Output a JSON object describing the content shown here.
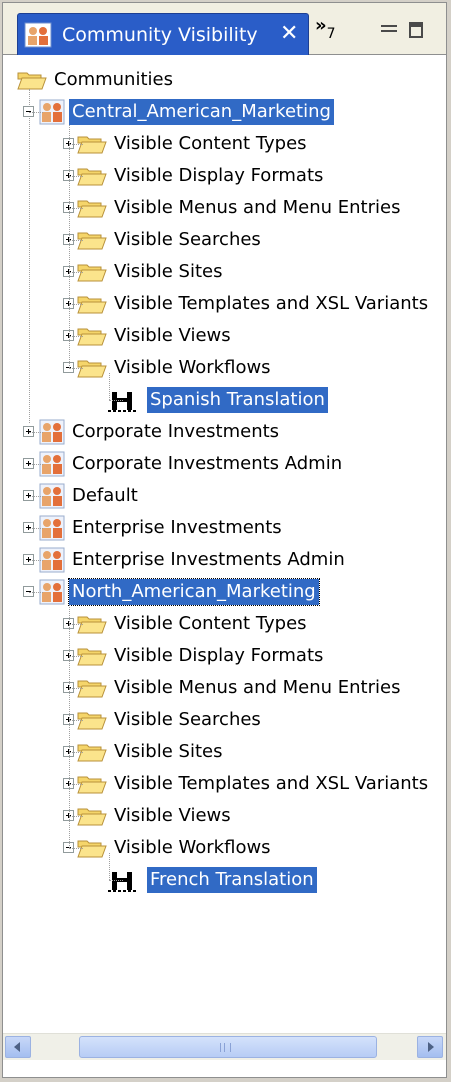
{
  "view": {
    "title": "Community Visibility",
    "close_label": "✕",
    "overflow_label": "»",
    "overflow_count": "7"
  },
  "tree": {
    "root": "Communities",
    "communities": [
      {
        "name": "Central_American_Marketing",
        "expanded": true,
        "selected": true,
        "folders": [
          "Visible Content Types",
          "Visible Display Formats",
          "Visible Menus and Menu Entries",
          "Visible Searches",
          "Visible Sites",
          "Visible Templates and XSL Variants",
          "Visible Views",
          "Visible Workflows"
        ],
        "workflow": "Spanish Translation"
      },
      {
        "name": "Corporate Investments",
        "expanded": false
      },
      {
        "name": "Corporate Investments Admin",
        "expanded": false
      },
      {
        "name": "Default",
        "expanded": false
      },
      {
        "name": "Enterprise Investments",
        "expanded": false
      },
      {
        "name": "Enterprise Investments Admin",
        "expanded": false
      },
      {
        "name": "North_American_Marketing",
        "expanded": true,
        "selected": true,
        "focused": true,
        "folders": [
          "Visible Content Types",
          "Visible Display Formats",
          "Visible Menus and Menu Entries",
          "Visible Searches",
          "Visible Sites",
          "Visible Templates and XSL Variants",
          "Visible Views",
          "Visible Workflows"
        ],
        "workflow": "French Translation"
      }
    ]
  },
  "colors": {
    "selection": "#316ac5",
    "tab_active": "#2a5dc8",
    "folder": "#f5d56a"
  }
}
